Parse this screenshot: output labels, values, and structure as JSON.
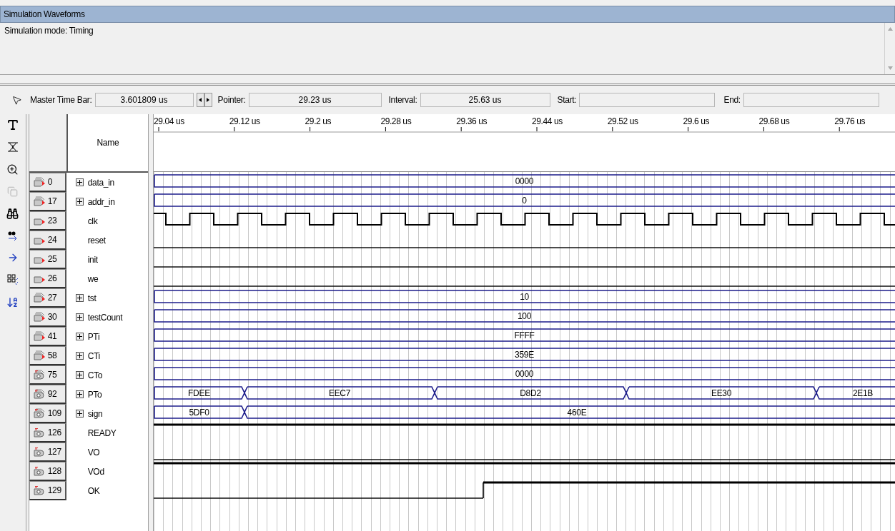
{
  "title": "Simulation Waveforms",
  "mode_text": "Simulation mode: Timing",
  "toolbar": {
    "master_time_bar": {
      "label": "Master Time Bar:",
      "value": "3.601809 us"
    },
    "pointer": {
      "label": "Pointer:",
      "value": "29.23 us"
    },
    "interval": {
      "label": "Interval:",
      "value": "25.63 us"
    },
    "start": {
      "label": "Start:"
    },
    "end": {
      "label": "End:"
    }
  },
  "name_header": "Name",
  "time_ticks": [
    "29.04 us",
    "29.12 us",
    "29.2 us",
    "29.28 us",
    "29.36 us",
    "29.44 us",
    "29.52 us",
    "29.6 us",
    "29.68 us",
    "29.76 us"
  ],
  "signals": [
    {
      "id": "0",
      "output": false,
      "name": "data_in",
      "expandable": true,
      "kind": "bus",
      "segments": [
        {
          "value": "0000"
        }
      ]
    },
    {
      "id": "17",
      "output": false,
      "name": "addr_in",
      "expandable": true,
      "kind": "bus",
      "segments": [
        {
          "value": "0"
        }
      ]
    },
    {
      "id": "23",
      "output": false,
      "name": "clk",
      "expandable": false,
      "kind": "clock"
    },
    {
      "id": "24",
      "output": false,
      "name": "reset",
      "expandable": false,
      "kind": "logic",
      "segments": [
        {
          "high": false
        }
      ]
    },
    {
      "id": "25",
      "output": false,
      "name": "init",
      "expandable": false,
      "kind": "logic",
      "segments": [
        {
          "high": false
        }
      ]
    },
    {
      "id": "26",
      "output": false,
      "name": "we",
      "expandable": false,
      "kind": "logic",
      "segments": [
        {
          "high": false
        }
      ]
    },
    {
      "id": "27",
      "output": false,
      "name": "tst",
      "expandable": true,
      "kind": "bus",
      "segments": [
        {
          "value": "10"
        }
      ]
    },
    {
      "id": "30",
      "output": false,
      "name": "testCount",
      "expandable": true,
      "kind": "bus",
      "segments": [
        {
          "value": "100"
        }
      ]
    },
    {
      "id": "41",
      "output": false,
      "name": "PTi",
      "expandable": true,
      "kind": "bus",
      "segments": [
        {
          "value": "FFFF"
        }
      ]
    },
    {
      "id": "58",
      "output": false,
      "name": "CTi",
      "expandable": true,
      "kind": "bus",
      "segments": [
        {
          "value": "359E"
        }
      ]
    },
    {
      "id": "75",
      "output": true,
      "name": "CTo",
      "expandable": true,
      "kind": "bus",
      "segments": [
        {
          "value": "0000"
        }
      ]
    },
    {
      "id": "92",
      "output": true,
      "name": "PTo",
      "expandable": true,
      "kind": "bus",
      "segments": [
        {
          "value": "FDEE"
        },
        {
          "value": "EEC7"
        },
        {
          "value": "D8D2"
        },
        {
          "value": "EE30"
        },
        {
          "value": "2E1B"
        }
      ]
    },
    {
      "id": "109",
      "output": true,
      "name": "sign",
      "expandable": true,
      "kind": "bus",
      "segments": [
        {
          "value": "5DF0"
        },
        {
          "value": "460E"
        }
      ]
    },
    {
      "id": "126",
      "output": true,
      "name": "READY",
      "expandable": false,
      "kind": "logic",
      "segments": [
        {
          "high": true
        }
      ]
    },
    {
      "id": "127",
      "output": true,
      "name": "VO",
      "expandable": false,
      "kind": "logic",
      "segments": [
        {
          "high": false
        }
      ]
    },
    {
      "id": "128",
      "output": true,
      "name": "VOd",
      "expandable": false,
      "kind": "logic",
      "segments": [
        {
          "high": true
        }
      ]
    },
    {
      "id": "129",
      "output": true,
      "name": "OK",
      "expandable": false,
      "kind": "logic",
      "segments": [
        {
          "high": false
        },
        {
          "high": true
        }
      ]
    }
  ]
}
